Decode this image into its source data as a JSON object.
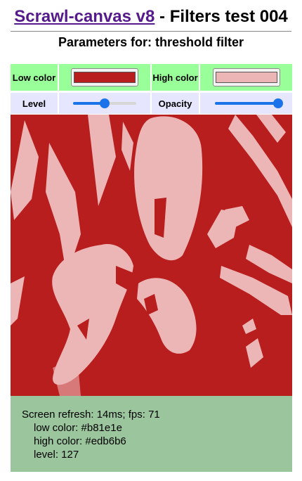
{
  "header": {
    "link_text": "Scrawl-canvas v8",
    "title_rest": " - Filters test 004",
    "subtitle": "Parameters for: threshold filter"
  },
  "controls": {
    "low_color_label": "Low color",
    "low_color_value": "#b81e1e",
    "high_color_label": "High color",
    "high_color_value": "#edb6b6",
    "level_label": "Level",
    "level_fraction": 0.5,
    "opacity_label": "Opacity",
    "opacity_fraction": 1.0
  },
  "report": {
    "refresh": "Screen refresh: 14ms; fps: 71",
    "low": "low color: #b81e1e",
    "high": "high color: #edb6b6",
    "level": "level: 127"
  },
  "colors": {
    "low": "#b81e1e",
    "high": "#edb6b6",
    "control_green": "#99ff99",
    "control_lavender": "#e6e6ff",
    "report_bg": "#9bc59d"
  }
}
